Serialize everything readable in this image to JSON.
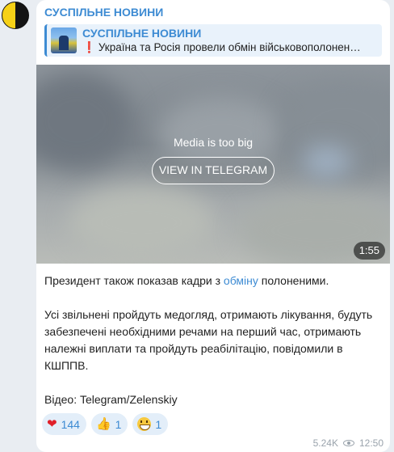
{
  "channel": {
    "name": "СУСПІЛЬНЕ НОВИНИ",
    "colors": {
      "accent": "#3d8bd3",
      "bubble": "#ffffff",
      "background": "#e9edf2"
    }
  },
  "reply": {
    "title": "СУСПІЛЬНЕ НОВИНИ",
    "text": "Україна та Росія провели обмін військовополонен…",
    "exclamation": "❗"
  },
  "media": {
    "message": "Media is too big",
    "button_label": "VIEW IN TELEGRAM",
    "duration": "1:55"
  },
  "post": {
    "line1_before": "Президент також показав кадри з ",
    "line1_link": "обміну",
    "line1_after": " полоненими.",
    "paragraph2": "Усі звільнені пройдуть медогляд, отримають лікування, будуть забезпечені необхідними речами на перший час, отримають належні виплати та пройдуть реабілітацію, повідомили в КШППВ.",
    "credit": "Відео: Telegram/Zelenskiy"
  },
  "reactions": [
    {
      "icon": "red-heart-icon",
      "emoji": "❤",
      "count": "144"
    },
    {
      "icon": "thumbs-up-icon",
      "emoji": "👍",
      "count": "1"
    },
    {
      "icon": "grinning-face-icon",
      "emoji": "😁",
      "count": "1"
    }
  ],
  "meta": {
    "views": "5.24K",
    "time": "12:50"
  }
}
